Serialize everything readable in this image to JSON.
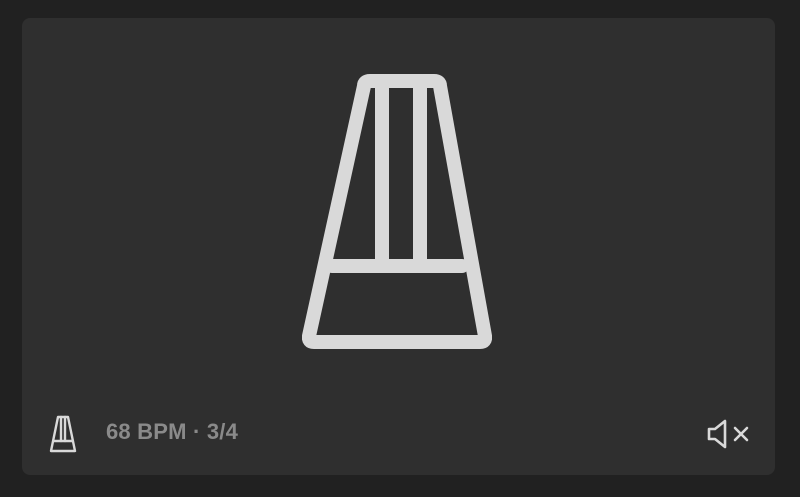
{
  "status": {
    "text": "68 BPM · 3/4"
  },
  "icons": {
    "hero": "metronome-icon",
    "small": "metronome-icon",
    "mute": "speaker-muted-icon"
  },
  "colors": {
    "background": "#212121",
    "card": "#2f2f2f",
    "icon": "#d9d9d9",
    "status_text": "#8a8a8a"
  }
}
